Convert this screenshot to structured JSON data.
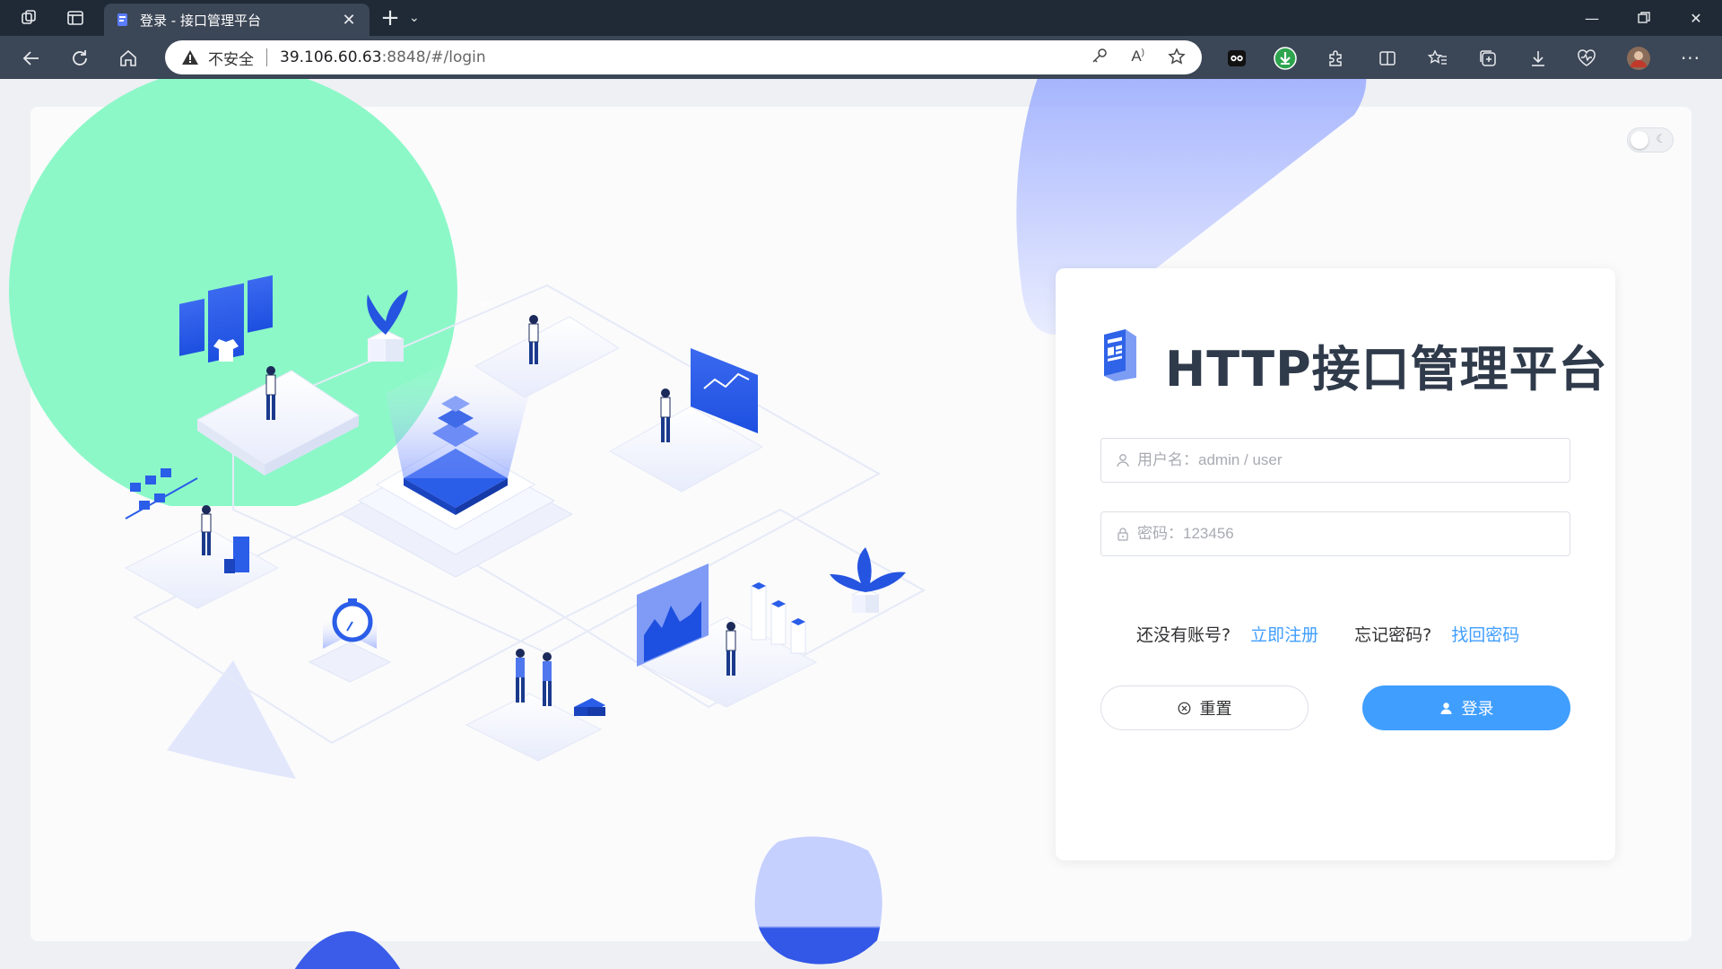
{
  "browser": {
    "tab_title": "登录 - 接口管理平台",
    "address": {
      "security_label": "不安全",
      "url_host": "39.106.60.63",
      "url_rest": ":8848/#/login"
    }
  },
  "login": {
    "title": "HTTP接口管理平台",
    "username_placeholder": "用户名：admin / user",
    "password_placeholder": "密码：123456",
    "no_account_text": "还没有账号?",
    "register_link": "立即注册",
    "forgot_text": "忘记密码?",
    "recover_link": "找回密码",
    "reset_button": "重置",
    "login_button": "登录"
  },
  "colors": {
    "primary": "#409eff",
    "brand_blue": "#2254e6",
    "green_blob": "#86f8c4",
    "purple_blob": "#a9b6ff"
  }
}
